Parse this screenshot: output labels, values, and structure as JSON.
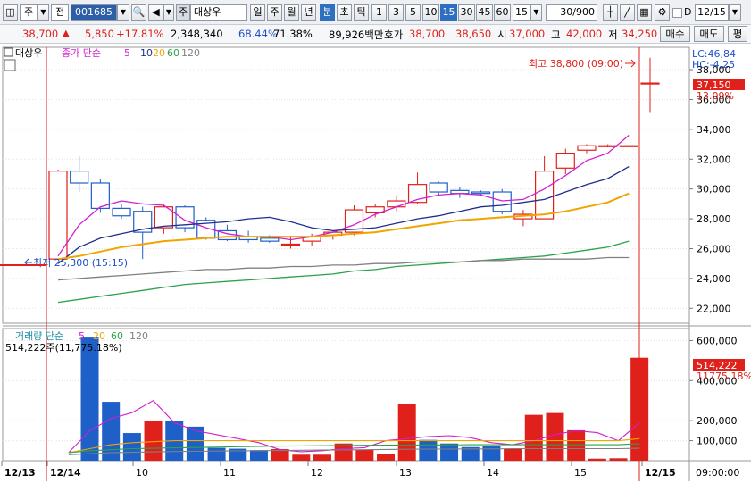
{
  "toolbar": {
    "market_label": "주",
    "type_label": "전",
    "code": "001685",
    "name": "대상우",
    "periods": [
      "일",
      "주",
      "월",
      "년",
      "분",
      "초",
      "틱"
    ],
    "active_period": "분",
    "intervals": [
      "1",
      "3",
      "5",
      "10",
      "15",
      "30",
      "45",
      "60"
    ],
    "active_interval": "15",
    "interval_select": "15",
    "count": "30",
    "count_max": "/900",
    "d_label": "D",
    "date": "12/15"
  },
  "quote": {
    "price": "38,700",
    "change": "5,850",
    "change_pct": "+17.81%",
    "volume": "2,348,340",
    "vol_ratio": "68.44%",
    "turnover_ratio": "71.38%",
    "amount": "89,926백만",
    "ask_label": "호가",
    "ask": "38,700",
    "bid": "38,650",
    "open_label": "시",
    "open": "37,000",
    "high_label": "고",
    "high": "42,000",
    "low_label": "저",
    "low": "34,250",
    "buy_btn": "매수",
    "sell_btn": "매도",
    "extra_btn": "평"
  },
  "price_panel": {
    "name_label": "대상우",
    "legend_close": "종가 단순",
    "ma_periods": [
      "5",
      "10",
      "20",
      "60",
      "120"
    ],
    "ma_colors": [
      "#d21ed0",
      "#1f2f8e",
      "#f0a500",
      "#2aa24a",
      "#808080"
    ],
    "high_note": "최고 38,800 (09:00)",
    "low_note": "최저 25,300 (15:15)",
    "lc": "LC:46,84",
    "hc": "HC:-4,25",
    "current_label": "37,150",
    "current_pct": "13.09%",
    "yticks": [
      "38,000",
      "36,000",
      "34,000",
      "32,000",
      "30,000",
      "28,000",
      "26,000",
      "24,000",
      "22,000"
    ]
  },
  "volume_panel": {
    "legend_label": "거래량 단순",
    "ma_periods": [
      "5",
      "20",
      "60",
      "120"
    ],
    "info": "514,222주(11,775.18%)",
    "current_label": "514,222",
    "current_pct": "11775.18%",
    "yticks": [
      "600,000",
      "400,000",
      "200,000",
      "100,000"
    ]
  },
  "xaxis": {
    "labels": [
      "12/13",
      "12/14",
      "10",
      "11",
      "12",
      "13",
      "14",
      "15",
      "12/15"
    ],
    "time_label": "09:00:00"
  },
  "colors": {
    "up": "#e0201a",
    "down": "#1f5fc8",
    "accent": "#2f6fbf"
  },
  "chart_data": {
    "type": "candlestick",
    "series": [
      {
        "name": "price",
        "values": [
          [
            25300,
            31200,
            25300,
            31300
          ],
          [
            31200,
            30400,
            29800,
            32200
          ],
          [
            30400,
            28700,
            28400,
            30700
          ],
          [
            28700,
            28200,
            28000,
            29000
          ],
          [
            28500,
            27100,
            25300,
            28800
          ],
          [
            27400,
            28800,
            27000,
            29000
          ],
          [
            28800,
            27400,
            27100,
            28900
          ],
          [
            27900,
            26700,
            26600,
            28100
          ],
          [
            27200,
            26600,
            26500,
            27600
          ],
          [
            26800,
            26600,
            26400,
            27200
          ],
          [
            26700,
            26500,
            26400,
            26900
          ],
          [
            26300,
            26300,
            26000,
            26800
          ],
          [
            26500,
            26800,
            26200,
            27000
          ],
          [
            26900,
            27100,
            26600,
            27200
          ],
          [
            27100,
            28600,
            26900,
            28900
          ],
          [
            28400,
            28800,
            28100,
            29000
          ],
          [
            28800,
            29200,
            28500,
            29500
          ],
          [
            29100,
            30300,
            29000,
            31100
          ],
          [
            30400,
            29800,
            29600,
            30500
          ],
          [
            29900,
            29700,
            29400,
            30100
          ],
          [
            29800,
            29700,
            29500,
            29900
          ],
          [
            29800,
            28500,
            28300,
            30000
          ],
          [
            28000,
            28300,
            27500,
            28600
          ],
          [
            28000,
            31200,
            28000,
            32200
          ],
          [
            31400,
            32400,
            31000,
            32700
          ],
          [
            32600,
            32900,
            32400,
            33000
          ],
          [
            32900,
            32900,
            32800,
            33000
          ],
          [
            32900,
            32900,
            32900,
            32900
          ],
          [
            37100,
            37100,
            35100,
            38800
          ]
        ]
      },
      {
        "name": "volume",
        "values": [
          0,
          615000,
          294000,
          138000,
          199000,
          198000,
          170000,
          64000,
          60000,
          53000,
          58000,
          30000,
          30000,
          86000,
          55000,
          35000,
          282000,
          104000,
          86000,
          68000,
          74000,
          60000,
          229000,
          238000,
          152000,
          10000,
          12000,
          514222
        ]
      }
    ],
    "ma5": [
      25500,
      27600,
      28800,
      29200,
      29000,
      28900,
      27900,
      27400,
      27000,
      26800,
      26800,
      26600,
      26800,
      27100,
      27600,
      28300,
      28800,
      29300,
      29600,
      29700,
      29600,
      29200,
      29300,
      30000,
      30900,
      31900,
      32400,
      33600
    ],
    "ma10": [
      25000,
      26100,
      26700,
      27000,
      27300,
      27500,
      27600,
      27700,
      27800,
      28000,
      28100,
      27800,
      27400,
      27200,
      27300,
      27400,
      27700,
      28000,
      28200,
      28500,
      28800,
      28900,
      29100,
      29300,
      29800,
      30300,
      30700,
      31500
    ],
    "ma20": [
      25300,
      25500,
      25800,
      26100,
      26300,
      26500,
      26600,
      26700,
      26800,
      26800,
      26800,
      26800,
      26800,
      26900,
      27000,
      27100,
      27300,
      27500,
      27700,
      27900,
      28000,
      28100,
      28200,
      28300,
      28500,
      28800,
      29100,
      29700
    ],
    "ma60": [
      22400,
      22600,
      22800,
      23000,
      23200,
      23400,
      23600,
      23700,
      23800,
      23900,
      24000,
      24100,
      24200,
      24300,
      24500,
      24600,
      24800,
      24900,
      25000,
      25100,
      25200,
      25300,
      25400,
      25500,
      25700,
      25900,
      26100,
      26500
    ],
    "ma120": [
      23900,
      24000,
      24100,
      24200,
      24300,
      24400,
      24500,
      24600,
      24600,
      24700,
      24700,
      24800,
      24800,
      24900,
      24900,
      25000,
      25000,
      25100,
      25100,
      25100,
      25200,
      25200,
      25300,
      25300,
      25300,
      25300,
      25400,
      25400
    ],
    "vma5": [
      40000,
      150000,
      210000,
      240000,
      300000,
      190000,
      150000,
      130000,
      110000,
      90000,
      55000,
      45000,
      50000,
      60000,
      65000,
      100000,
      110000,
      120000,
      125000,
      115000,
      90000,
      80000,
      100000,
      130000,
      150000,
      140000,
      100000,
      190000
    ],
    "vma20": [
      40000,
      60000,
      80000,
      90000,
      95000,
      100000,
      100000,
      100000,
      100000,
      100000,
      100000,
      100000,
      100000,
      100000,
      100000,
      100000,
      100000,
      100000,
      100000,
      100000,
      100000,
      100000,
      100000,
      100000,
      100000,
      100000,
      100000,
      110000
    ],
    "vma60": [
      40000,
      50000,
      55000,
      60000,
      62000,
      64000,
      66000,
      68000,
      70000,
      72000,
      73000,
      74000,
      75000,
      76000,
      77000,
      78000,
      78000,
      79000,
      79000,
      80000,
      80000,
      80000,
      80000,
      80000,
      80000,
      80000,
      80000,
      85000
    ],
    "vma120": [
      30000,
      35000,
      40000,
      42000,
      44000,
      46000,
      47000,
      48000,
      49000,
      50000,
      51000,
      52000,
      53000,
      54000,
      55000,
      56000,
      57000,
      58000,
      58000,
      59000,
      59000,
      60000,
      60000,
      60000,
      60000,
      60000,
      60000,
      62000
    ],
    "price_ylim": [
      21000,
      39500
    ],
    "volume_ylim": [
      0,
      660000
    ],
    "grid": true,
    "legend": "top-left"
  }
}
